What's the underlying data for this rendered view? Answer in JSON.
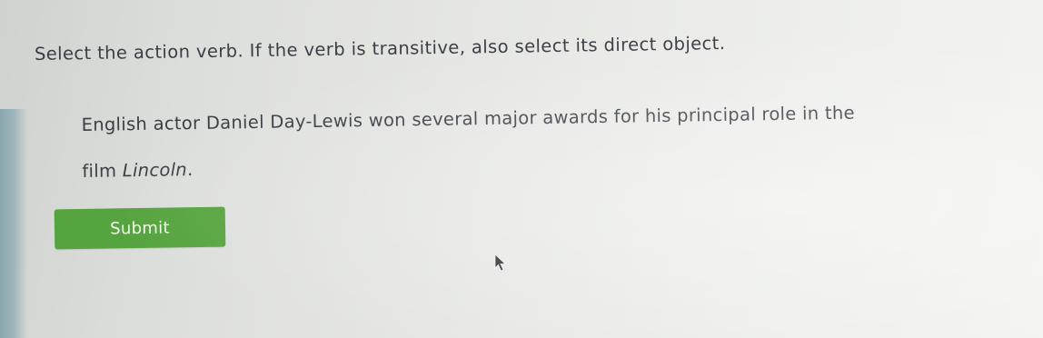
{
  "question": {
    "prompt": "Select the action verb. If the verb is transitive, also select its direct object.",
    "sentence": {
      "line1": "English actor Daniel Day-Lewis won several major awards for his principal role in the",
      "line2_lead": "film ",
      "line2_title": "Lincoln",
      "line2_tail": "."
    }
  },
  "actions": {
    "submit_label": "Submit"
  },
  "colors": {
    "submit_background": "#56a43f",
    "text": "#3b3e44"
  },
  "icons": {
    "pointer": "mouse-pointer-icon"
  }
}
